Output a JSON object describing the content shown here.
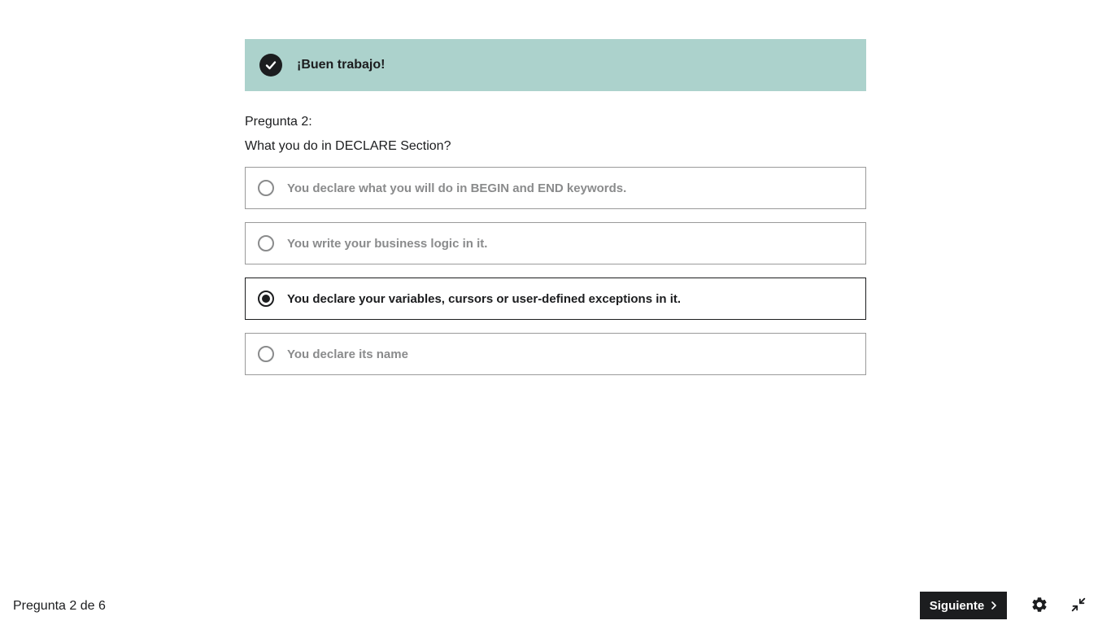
{
  "feedback": {
    "message": "¡Buen trabajo!",
    "icon": "check-circle-icon",
    "background_color": "#acd2cc"
  },
  "question": {
    "number_label": "Pregunta 2:",
    "text": "What you do in DECLARE Section?",
    "options": [
      {
        "label": "You declare what you will do in BEGIN and END keywords.",
        "selected": false
      },
      {
        "label": "You write your business logic in it.",
        "selected": false
      },
      {
        "label": "You declare your variables, cursors or user-defined exceptions in it.",
        "selected": true
      },
      {
        "label": "You declare its name",
        "selected": false
      }
    ]
  },
  "footer": {
    "progress": "Pregunta 2 de 6",
    "next_label": "Siguiente",
    "next_icon": "chevron-right-icon",
    "settings_icon": "gear-icon",
    "exit_fullscreen_icon": "exit-fullscreen-icon"
  }
}
